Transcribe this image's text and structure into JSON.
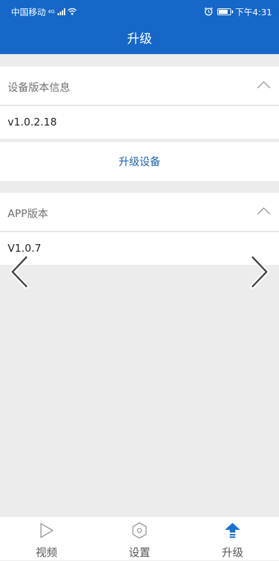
{
  "status_bar": {
    "carrier": "中国移动",
    "network": "4G",
    "time": "下午4:31"
  },
  "header": {
    "title": "升级"
  },
  "device_section": {
    "label": "设备版本信息",
    "version": "v1.0.2.18",
    "upgrade_button": "升级设备"
  },
  "app_section": {
    "label": "APP版本",
    "version": "V1.0.7"
  },
  "tabs": [
    {
      "label": "视频",
      "icon": "play-icon",
      "active": false
    },
    {
      "label": "设置",
      "icon": "settings-icon",
      "active": false
    },
    {
      "label": "升级",
      "icon": "upgrade-arrow-icon",
      "active": true
    }
  ],
  "colors": {
    "header_bg": "#1567c8",
    "link": "#1a5fa8",
    "background": "#ececec",
    "active_tab_icon": "#1a72d2"
  }
}
